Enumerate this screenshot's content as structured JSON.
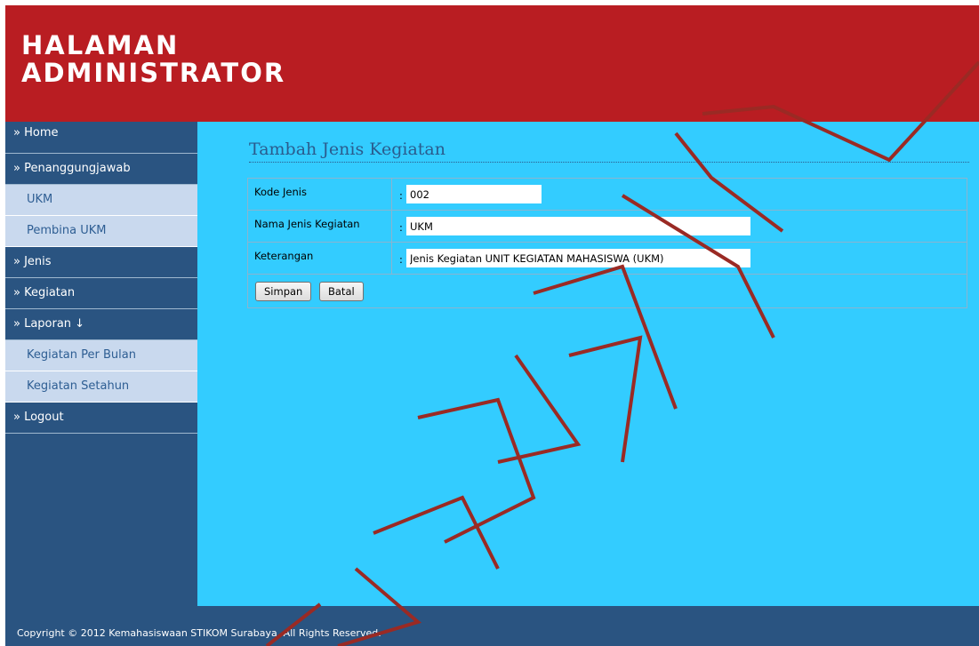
{
  "header": {
    "title": "HALAMAN ADMINISTRATOR"
  },
  "sidebar": {
    "items": [
      {
        "label": "» Home",
        "type": "main"
      },
      {
        "label": "» Penanggungjawab",
        "type": "main"
      },
      {
        "label": "UKM",
        "type": "sub"
      },
      {
        "label": "Pembina UKM",
        "type": "sub"
      },
      {
        "label": "» Jenis",
        "type": "main"
      },
      {
        "label": "» Kegiatan",
        "type": "main"
      },
      {
        "label": "» Laporan ↓",
        "type": "main"
      },
      {
        "label": "Kegiatan Per Bulan",
        "type": "sub"
      },
      {
        "label": "Kegiatan Setahun",
        "type": "sub"
      },
      {
        "label": "» Logout",
        "type": "main"
      }
    ]
  },
  "main": {
    "title": "Tambah Jenis Kegiatan",
    "form": {
      "separator": ":",
      "kode_jenis": {
        "label": "Kode Jenis",
        "value": "002"
      },
      "nama_jenis": {
        "label": "Nama Jenis Kegiatan",
        "value": "UKM"
      },
      "keterangan": {
        "label": "Keterangan",
        "value": "Jenis Kegiatan UNIT KEGIATAN MAHASISWA (UKM)"
      },
      "save_label": "Simpan",
      "cancel_label": "Batal"
    }
  },
  "footer": {
    "text": "Copyright © 2012 Kemahasiswaan STIKOM Surabaya. All Rights Reserved."
  },
  "colors": {
    "header_bg": "#b91d22",
    "sidebar_bg": "#2a5481",
    "sub_item_bg": "#c9d9ee",
    "content_bg": "#33ccff",
    "watermark": "#9a2a24"
  }
}
